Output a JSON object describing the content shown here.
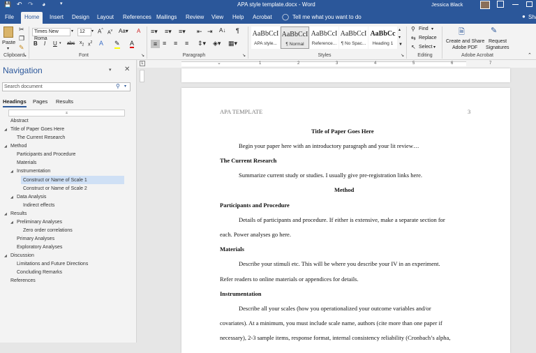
{
  "titlebar": {
    "doc_title": "APA style template.docx  -  Word",
    "user": "Jessica Black"
  },
  "tabs": [
    "File",
    "Home",
    "Insert",
    "Design",
    "Layout",
    "References",
    "Mailings",
    "Review",
    "View",
    "Help",
    "Acrobat"
  ],
  "tell_me": "Tell me what you want to do",
  "share": "Sha",
  "ribbon": {
    "paste": "Paste",
    "font_name": "Times New Roma",
    "font_size": "12",
    "groups": {
      "clipboard": "Clipboard",
      "font": "Font",
      "paragraph": "Paragraph",
      "styles": "Styles",
      "editing": "Editing",
      "acrobat": "Adobe Acrobat"
    },
    "styles": [
      {
        "preview": "AaBbCcI",
        "name": "APA style..."
      },
      {
        "preview": "AaBbCcI",
        "name": "¶ Normal"
      },
      {
        "preview": "AaBbCcI",
        "name": "Reference..."
      },
      {
        "preview": "AaBbCcI",
        "name": "¶ No Spac..."
      },
      {
        "preview": "AaBbCc",
        "name": "Heading 1"
      }
    ],
    "find": "Find",
    "replace": "Replace",
    "select": "Select",
    "create_share": [
      "Create and Share",
      "Adobe PDF"
    ],
    "request_sig": [
      "Request",
      "Signatures"
    ]
  },
  "nav": {
    "title": "Navigation",
    "search_placeholder": "Search document",
    "tabs": [
      "Headings",
      "Pages",
      "Results"
    ],
    "items": [
      {
        "label": "Abstract"
      },
      {
        "label": "Title of Paper Goes Here"
      },
      {
        "label": "The Current Research"
      },
      {
        "label": "Method"
      },
      {
        "label": "Participants and Procedure"
      },
      {
        "label": "Materials"
      },
      {
        "label": "Instrumentation"
      },
      {
        "label": "Construct or Name of Scale 1"
      },
      {
        "label": "Construct or Name of Scale 2"
      },
      {
        "label": "Data Analysis"
      },
      {
        "label": "Indirect effects"
      },
      {
        "label": "Results"
      },
      {
        "label": "Preliminary Analyses"
      },
      {
        "label": "Zero order correlations"
      },
      {
        "label": "Primary Analyses"
      },
      {
        "label": "Exploratory Analyses"
      },
      {
        "label": "Discussion"
      },
      {
        "label": "Limitations and Future Directions"
      },
      {
        "label": "Concluding Remarks"
      },
      {
        "label": "References"
      }
    ]
  },
  "ruler": {
    "ticks": [
      "1",
      "2",
      "3",
      "4",
      "5",
      "6",
      "7"
    ]
  },
  "document": {
    "header_left": "APA TEMPLATE",
    "page_number": "3",
    "lines": [
      "Title of Paper Goes Here",
      "Begin your paper here with an introductory paragraph and your lit review…",
      "The Current Research",
      "Summarize current study or studies. I usually give pre-registration links here.",
      "Method",
      "Participants and Procedure",
      "Details of participants and procedure. If either is extensive, make a separate section for",
      "each. Power analyses go here.",
      "Materials",
      "Describe your stimuli etc. This will be where you describe your IV in an experiment.",
      "Refer readers to online materials or appendices for details.",
      "Instrumentation",
      "Describe all your scales (how you operationalized your outcome variables and/or",
      "covariates). At a minimum, you must include scale name, authors (cite more than one paper if",
      "necessary), 2-3 sample items, response format, internal consistency reliability (Cronbach’s alpha,"
    ]
  }
}
